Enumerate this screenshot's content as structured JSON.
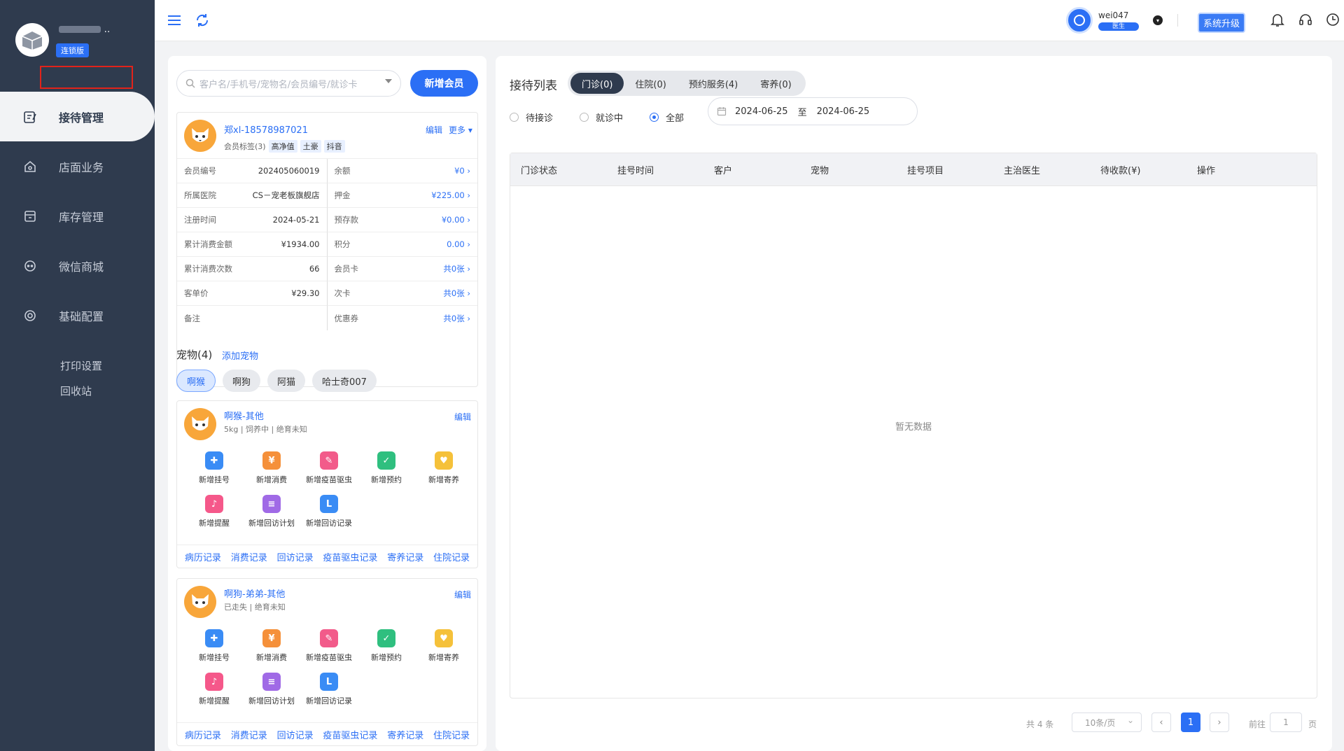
{
  "sidebar": {
    "store_name": "",
    "edition": "连锁版",
    "nav": [
      {
        "label": "接待管理",
        "icon": "reception-icon",
        "active": true
      },
      {
        "label": "店面业务",
        "icon": "store-icon"
      },
      {
        "label": "库存管理",
        "icon": "inventory-icon"
      },
      {
        "label": "微信商城",
        "icon": "wechat-shop-icon"
      },
      {
        "label": "基础配置",
        "icon": "settings-icon"
      }
    ],
    "sub": [
      "打印设置",
      "回收站"
    ]
  },
  "header": {
    "user_name": "wei047",
    "user_role": "医生",
    "upgrade": "系统升级"
  },
  "left": {
    "search_placeholder": "客户名/手机号/宠物名/会员编号/就诊卡",
    "add_member": "新增会员",
    "member": {
      "name": "郑xl-18578987021",
      "tags_label": "会员标签(3)",
      "tags": [
        "高净值",
        "土豪",
        "抖音"
      ],
      "edit": "编辑",
      "more": "更多",
      "rows": [
        [
          {
            "k": "会员编号",
            "v": "202405060019"
          },
          {
            "k": "余额",
            "v": "¥0 ›"
          }
        ],
        [
          {
            "k": "所属医院",
            "v": "CS－宠老板旗舰店"
          },
          {
            "k": "押金",
            "v": "¥225.00 ›"
          }
        ],
        [
          {
            "k": "注册时间",
            "v": "2024-05-21"
          },
          {
            "k": "预存款",
            "v": "¥0.00 ›"
          }
        ],
        [
          {
            "k": "累计消费金额",
            "v": "¥1934.00"
          },
          {
            "k": "积分",
            "v": "0.00 ›"
          }
        ],
        [
          {
            "k": "累计消费次数",
            "v": "66"
          },
          {
            "k": "会员卡",
            "v": "共0张 ›"
          }
        ],
        [
          {
            "k": "客单价",
            "v": "¥29.30"
          },
          {
            "k": "次卡",
            "v": "共0张 ›"
          }
        ],
        [
          {
            "k": "备注",
            "v": ""
          },
          {
            "k": "优惠券",
            "v": "共0张 ›"
          }
        ]
      ]
    },
    "pets_title": "宠物(4)",
    "add_pet": "添加宠物",
    "pet_tabs": [
      "啊猴",
      "啊狗",
      "阿猫",
      "哈士奇007"
    ],
    "actions": [
      "新增挂号",
      "新增消费",
      "新增疫苗驱虫",
      "新增预约",
      "新增寄养",
      "新增提醒",
      "新增回访计划",
      "新增回访记录"
    ],
    "action_glyphs": [
      "✚",
      "¥",
      "✎",
      "✓",
      "♥",
      "♪",
      "≡",
      "L"
    ],
    "records": [
      "病历记录",
      "消费记录",
      "回访记录",
      "疫苗驱虫记录",
      "寄养记录",
      "住院记录"
    ],
    "pet_cards": [
      {
        "name": "啊猴-其他",
        "sub": "5kg | 饲养中 |  绝育未知",
        "edit": "编辑"
      },
      {
        "name": "啊狗-弟弟-其他",
        "sub": "已走失 |  绝育未知",
        "edit": "编辑"
      }
    ]
  },
  "right": {
    "title": "接待列表",
    "tabs": [
      "门诊(0)",
      "住院(0)",
      "预约服务(4)",
      "寄养(0)"
    ],
    "radios": [
      "待接诊",
      "就诊中",
      "全部"
    ],
    "date_from": "2024-06-25",
    "date_to": "2024-06-25",
    "date_sep": "至",
    "columns": [
      "门诊状态",
      "挂号时间",
      "客户",
      "宠物",
      "挂号项目",
      "主治医生",
      "待收款(¥)",
      "操作"
    ],
    "empty": "暂无数据",
    "pager": {
      "total": "共 4 条",
      "size": "10条/页",
      "current": "1",
      "goto": "前往",
      "goto_value": "1",
      "suffix": "页"
    }
  }
}
